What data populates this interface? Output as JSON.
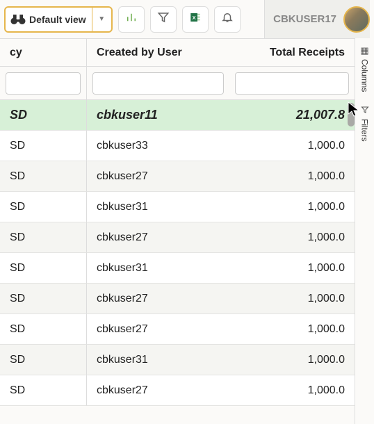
{
  "toolbar": {
    "view_label": "Default view"
  },
  "user": {
    "name": "CBKUSER17"
  },
  "columns": {
    "c0": "cy",
    "c1": "Created by User",
    "c2": "Total Receipts"
  },
  "sidebar": {
    "columns": "Columns",
    "filters": "Filters"
  },
  "total_row": {
    "currency": "SD",
    "user": "cbkuser11",
    "receipts": "21,007.8"
  },
  "rows": [
    {
      "currency": "SD",
      "user": "cbkuser33",
      "receipts": "1,000.0"
    },
    {
      "currency": "SD",
      "user": "cbkuser27",
      "receipts": "1,000.0"
    },
    {
      "currency": "SD",
      "user": "cbkuser31",
      "receipts": "1,000.0"
    },
    {
      "currency": "SD",
      "user": "cbkuser27",
      "receipts": "1,000.0"
    },
    {
      "currency": "SD",
      "user": "cbkuser31",
      "receipts": "1,000.0"
    },
    {
      "currency": "SD",
      "user": "cbkuser27",
      "receipts": "1,000.0"
    },
    {
      "currency": "SD",
      "user": "cbkuser27",
      "receipts": "1,000.0"
    },
    {
      "currency": "SD",
      "user": "cbkuser31",
      "receipts": "1,000.0"
    },
    {
      "currency": "SD",
      "user": "cbkuser27",
      "receipts": "1,000.0"
    }
  ]
}
